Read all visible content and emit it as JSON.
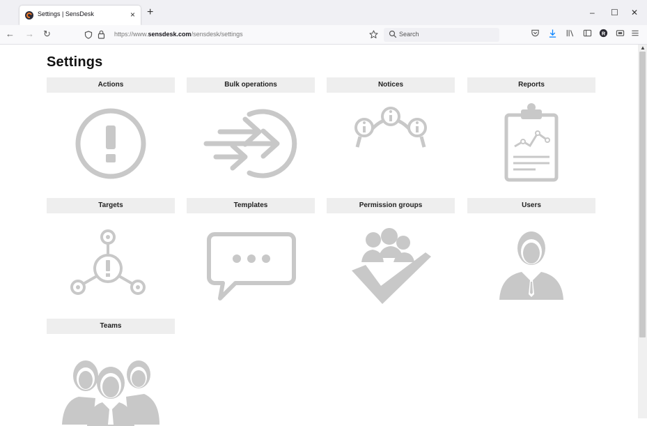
{
  "browser": {
    "tab_title": "Settings | SensDesk",
    "tab_close": "×",
    "new_tab": "+",
    "url_prefix": "https://www.",
    "url_domain": "sensdesk.com",
    "url_path": "/sensdesk/settings",
    "search_placeholder": "Search",
    "window_controls": [
      "–",
      "☐",
      "✕"
    ],
    "account_initial": "R"
  },
  "page": {
    "title": "Settings"
  },
  "tiles": [
    {
      "label": "Actions",
      "icon": "exclamation-circle-icon"
    },
    {
      "label": "Bulk operations",
      "icon": "arrows-into-circle-icon"
    },
    {
      "label": "Notices",
      "icon": "info-chain-icon"
    },
    {
      "label": "Reports",
      "icon": "clipboard-chart-icon"
    },
    {
      "label": "Targets",
      "icon": "target-network-icon"
    },
    {
      "label": "Templates",
      "icon": "speech-bubble-icon"
    },
    {
      "label": "Permission groups",
      "icon": "group-checkmark-icon"
    },
    {
      "label": "Users",
      "icon": "user-icon"
    },
    {
      "label": "Teams",
      "icon": "team-icon"
    }
  ],
  "colors": {
    "icon_gray": "#c8c8c8",
    "label_bg": "#eeeeee",
    "download_blue": "#0a84ff"
  }
}
